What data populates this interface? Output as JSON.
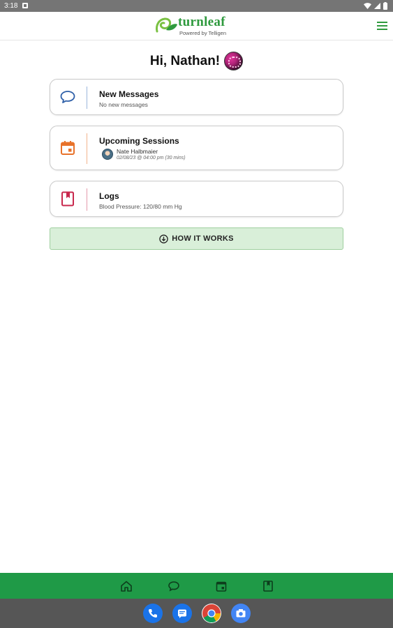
{
  "status_bar": {
    "time": "3:18"
  },
  "app_bar": {
    "logo_text": "turnleaf",
    "logo_subtitle": "Powered by Telligen",
    "brand_color": "#2f9a3e",
    "menu_icon": "hamburger-menu-icon"
  },
  "greeting": {
    "text": "Hi,  Nathan!"
  },
  "cards": {
    "messages": {
      "icon": "chat-bubble-icon",
      "title": "New Messages",
      "subtitle": "No new messages",
      "accent": "#2e5fa8"
    },
    "sessions": {
      "icon": "calendar-icon",
      "title": "Upcoming Sessions",
      "provider_name": "Nate Halbmaier",
      "session_time": "02/08/23 @ 04:00 pm (30 mins)",
      "accent": "#e8722a"
    },
    "logs": {
      "icon": "book-icon",
      "title": "Logs",
      "subtitle": "Blood Pressure: 120/80 mm Hg",
      "accent": "#c8284d"
    }
  },
  "how_it_works": {
    "label": "HOW IT WORKS",
    "icon": "arrow-down-circle-icon",
    "bg_color": "#d9efd9"
  },
  "bottom_nav": {
    "color": "#1f9a47",
    "items": [
      "home-icon",
      "chat-icon",
      "calendar-icon",
      "book-icon"
    ]
  },
  "dock": {
    "apps": [
      "phone-icon",
      "messages-icon",
      "chrome-icon",
      "camera-icon"
    ]
  }
}
